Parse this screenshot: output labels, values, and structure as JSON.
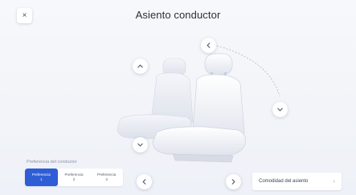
{
  "header": {
    "title": "Asiento conductor",
    "close_glyph": "×"
  },
  "controls": {
    "headrest_up": "chevron-left-icon",
    "headrest_down": "chevron-down-icon",
    "seat_up": "chevron-up-icon",
    "seat_down": "chevron-down-icon"
  },
  "preferences": {
    "hint": "Preferencia del conductor",
    "items": [
      {
        "label": "Preferencia",
        "number": "1"
      },
      {
        "label": "Preferencia",
        "number": "2"
      },
      {
        "label": "Preferencia",
        "number": "3"
      }
    ]
  },
  "footer": {
    "seat_info_label": "Comodidad del asiento",
    "seat_info_chevron": "›"
  },
  "colors": {
    "accent": "#2f5dd6",
    "background": "#eef1f7",
    "seat": "#e9ecf3"
  }
}
